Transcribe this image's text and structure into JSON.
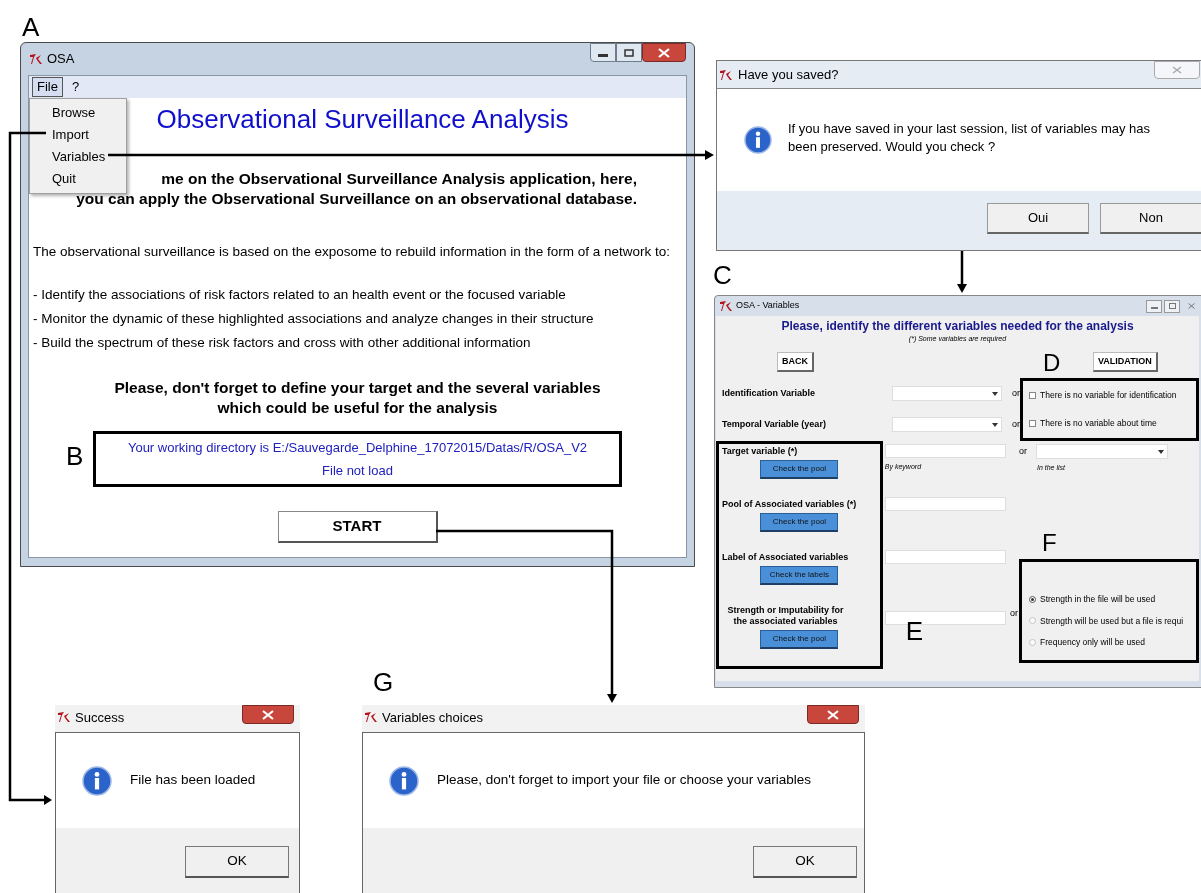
{
  "main_window": {
    "panel_label": "A",
    "title": "OSA",
    "menu_bar": [
      {
        "label": "File",
        "selected": true
      },
      {
        "label": "?",
        "selected": false
      }
    ],
    "file_menu": [
      "Browse",
      "Import",
      "Variables",
      "Quit"
    ],
    "heading": "Observational Surveillance Analysis",
    "welcome_lines": [
      "me on the Observational Surveillance Analysis application, here,",
      "you can apply the Observational Surveillance on an observational database."
    ],
    "intro": "The observational surveillance is based on the exposome to rebuild information in the form of a network to:",
    "bullets": [
      "- Identify the associations of risk factors related to an health event or the focused variable",
      "- Monitor the dynamic of these highlighted associations and analyze changes in their structure",
      "- Build the spectrum of these risk factors and cross with other additional information"
    ],
    "reminder_lines": [
      "Please, don't forget to define your target and the several variables",
      "which could be useful for the analysis"
    ],
    "info_box": {
      "label": "B",
      "lines": [
        "Your working directory is E:/Sauvegarde_Delphine_17072015/Datas/R/OSA_V2",
        "File not load"
      ]
    },
    "start_button": "START"
  },
  "saved_dialog": {
    "title": "Have you saved?",
    "message": "If you have saved in your last session, list of variables may has been preserved. Would you check ?",
    "buttons": [
      "Oui",
      "Non"
    ]
  },
  "variables_window": {
    "panel_label": "C",
    "title": "OSA - Variables",
    "heading": "Please, identify the different variables needed for the analysis",
    "note": "(*) Some variables are required",
    "back_button": "BACK",
    "validation_button": "VALIDATION",
    "d_label": "D",
    "id_rows": [
      {
        "label": "Identification Variable",
        "or": "or",
        "checkbox": {
          "label": "There is no variable for identification",
          "checked": false
        }
      },
      {
        "label": "Temporal Variable (year)",
        "or": "or",
        "checkbox": {
          "label": "There is no variable about time",
          "checked": false
        }
      }
    ],
    "e_label": "E",
    "pool_rows": [
      {
        "label": "Target variable (*)",
        "button": "Check the pool"
      },
      {
        "label": "Pool of Associated variables (*)",
        "button": "Check the pool"
      },
      {
        "label": "Label of Associated variables",
        "button": "Check the labels"
      },
      {
        "label": "Strength or Imputability for the associated variables",
        "button": "Check the pool"
      }
    ],
    "target_or": "or",
    "keyword_hint": "By keyword",
    "list_hint": "In the list",
    "strength_or": "or",
    "f_label": "F",
    "strength_options": [
      {
        "label": "Strength in the file will be used",
        "selected": true
      },
      {
        "label": "Strength will be used but a file is requi",
        "selected": false
      },
      {
        "label": "Frequency only will be used",
        "selected": false
      }
    ]
  },
  "success_dialog": {
    "title": "Success",
    "message": "File has been loaded",
    "button": "OK"
  },
  "choices_dialog": {
    "panel_label": "G",
    "title": "Variables choices",
    "message": "Please, don't forget to import your file or choose your variables",
    "button": "OK"
  }
}
